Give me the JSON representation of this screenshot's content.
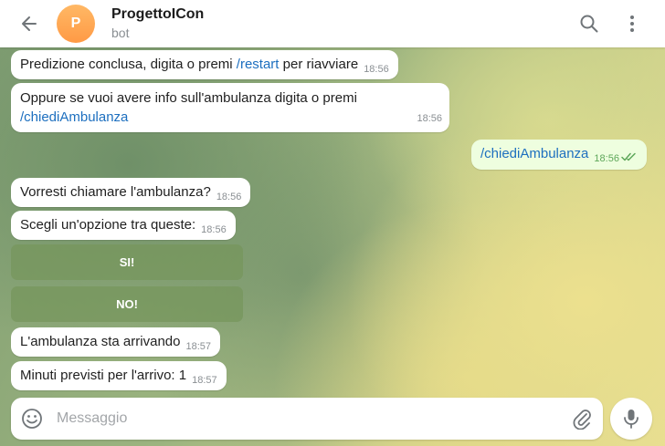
{
  "header": {
    "avatar_letter": "P",
    "title": "ProgettoICon",
    "subtitle": "bot"
  },
  "messages": [
    {
      "parts": [
        {
          "text": "Predizione conclusa, digita o premi "
        },
        {
          "text": "/restart",
          "cmd": true
        },
        {
          "text": " per riavviare"
        }
      ],
      "time": "18:56"
    },
    {
      "line1": "Oppure se vuoi avere info sull'ambulanza digita o premi",
      "line2_cmd": "/chiediAmbulanza",
      "time": "18:56"
    },
    {
      "text": "/chiediAmbulanza",
      "time": "18:56",
      "outgoing": true
    },
    {
      "text": "Vorresti chiamare l'ambulanza?",
      "time": "18:56"
    },
    {
      "text": "Scegli un'opzione tra queste:",
      "time": "18:56"
    },
    {
      "text": "L'ambulanza sta arrivando",
      "time": "18:57"
    },
    {
      "text": "Minuti previsti per l'arrivo: 1",
      "time": "18:57"
    }
  ],
  "keyboard": {
    "buttons": [
      "SI!",
      "NO!"
    ]
  },
  "composer": {
    "placeholder": "Messaggio"
  },
  "icons": {
    "back": "arrow-left-icon",
    "search": "search-icon",
    "menu": "more-vertical-icon",
    "emoji": "emoji-icon",
    "attach": "paperclip-icon",
    "mic": "microphone-icon",
    "read": "double-check-icon"
  },
  "colors": {
    "avatar": "#ff9a45",
    "command_link": "#1d6fbf",
    "outgoing_bubble": "#eefedf",
    "outgoing_time": "#5ea75a"
  }
}
